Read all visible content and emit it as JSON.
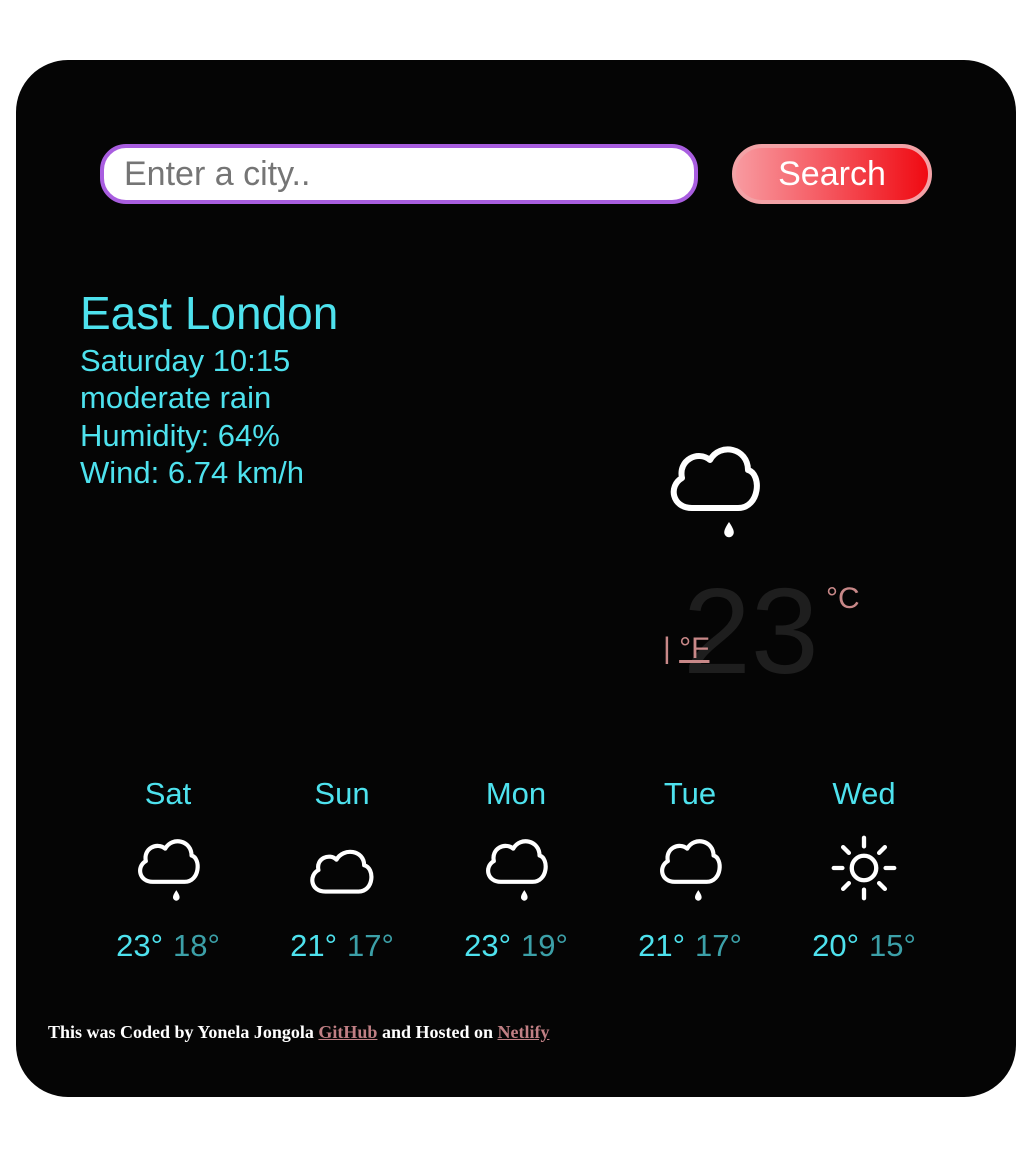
{
  "search": {
    "placeholder": "Enter a city..",
    "button_label": "Search"
  },
  "current": {
    "city": "East London",
    "datetime": "Saturday 10:15",
    "description": "moderate rain",
    "humidity": "Humidity: 64%",
    "wind": "Wind: 6.74 km/h",
    "icon": "rain-cloud-icon",
    "temperature": "23",
    "unit_celsius": "°C",
    "unit_separator": "|",
    "unit_fahrenheit": "°F"
  },
  "forecast": [
    {
      "day": "Sat",
      "icon": "rain-cloud-icon",
      "max": "23°",
      "min": "18°"
    },
    {
      "day": "Sun",
      "icon": "cloud-icon",
      "max": "21°",
      "min": "17°"
    },
    {
      "day": "Mon",
      "icon": "rain-cloud-icon",
      "max": "23°",
      "min": "19°"
    },
    {
      "day": "Tue",
      "icon": "rain-cloud-icon",
      "max": "21°",
      "min": "17°"
    },
    {
      "day": "Wed",
      "icon": "sun-icon",
      "max": "20°",
      "min": "15°"
    }
  ],
  "footer": {
    "text_1": "This was Coded by Yonela Jongola",
    "link_github": "GitHub",
    "text_2": "and Hosted on",
    "link_netlify": "Netlify"
  },
  "colors": {
    "background": "#050505",
    "text_accent": "#4ee2ee",
    "min_temp": "#3ca0a8",
    "unit_link": "#c88888",
    "search_border": "#a95ee0",
    "button_gradient_end": "#f00a12"
  }
}
